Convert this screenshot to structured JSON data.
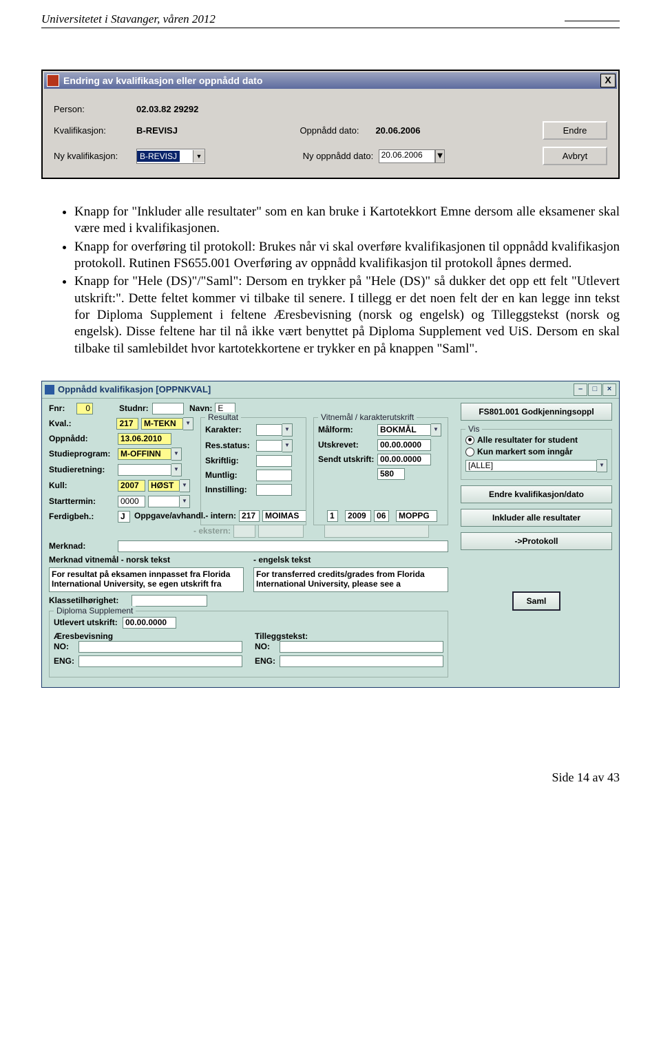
{
  "header": {
    "left": "Universitetet i Stavanger, våren 2012"
  },
  "dlg1": {
    "title": "Endring av kvalifikasjon eller oppnådd dato",
    "person_lbl": "Person:",
    "person_val": "02.03.82 29292",
    "kval_lbl": "Kvalifikasjon:",
    "kval_val": "B-REVISJ",
    "oppdato_lbl": "Oppnådd dato:",
    "oppdato_val": "20.06.2006",
    "nykval_lbl": "Ny kvalifikasjon:",
    "nykval_sel": "B-REVISJ",
    "nyoppdato_lbl": "Ny oppnådd dato:",
    "nyoppdato_val": "20.06.2006",
    "endre": "Endre",
    "avbryt": "Avbryt",
    "close": "X"
  },
  "bullets": {
    "b1": "Knapp for \"Inkluder alle resultater\" som en kan bruke i Kartotekkort Emne dersom alle eksamener skal være med i kvalifikasjonen.",
    "b2": "Knapp for overføring til protokoll: Brukes når vi skal overføre kvalifikasjonen til oppnådd kvalifikasjon protokoll. Rutinen FS655.001 Overføring av oppnådd kvalifikasjon til protokoll åpnes dermed.",
    "b3": "Knapp for \"Hele (DS)\"/\"Saml\": Dersom en trykker på \"Hele (DS)\" så dukker det opp ett felt \"Utlevert utskrift:\". Dette feltet kommer vi tilbake til senere. I tillegg er det noen felt der en kan legge inn tekst for Diploma Supplement i feltene Æresbevisning (norsk og engelsk) og Tilleggstekst (norsk og engelsk). Disse feltene har til nå ikke vært benyttet på Diploma Supplement ved UiS. Dersom en skal tilbake til samlebildet hvor kartotekkortene er trykker en på knappen \"Saml\"."
  },
  "dlg2": {
    "title": "Oppnådd kvalifikasjon [OPPNKVAL]",
    "fnr_lbl": "Fnr:",
    "fnr_val": "0",
    "studnr_lbl": "Studnr:",
    "navn_lbl": "Navn:",
    "navn_val": "E",
    "kval_lbl": "Kval.:",
    "kval_v1": "217",
    "kval_v2": "M-TEKN",
    "oppn_lbl": "Oppnådd:",
    "oppn_val": "13.06.2010",
    "stprog_lbl": "Studieprogram:",
    "stprog_val": "M-OFFINN",
    "stret_lbl": "Studieretning:",
    "kull_lbl": "Kull:",
    "kull_v1": "2007",
    "kull_v2": "HØST",
    "stt_lbl": "Starttermin:",
    "stt_val": "0000",
    "fb_lbl": "Ferdigbeh.:",
    "fb_val": "J",
    "oah_lbl": "Oppgave/avhandl.- intern:",
    "oah_v1": "217",
    "oah_v2": "MOIMAS",
    "oah_v3": "1",
    "oah_v4": "2009",
    "oah_v5": "06",
    "oah_v6": "MOPPG",
    "ekstern_lbl": "- ekstern:",
    "merk_lbl": "Merknad:",
    "res_leg": "Resultat",
    "kar_lbl": "Karakter:",
    "rs_lbl": "Res.status:",
    "skr_lbl": "Skriftlig:",
    "mun_lbl": "Muntlig:",
    "ins_lbl": "Innstilling:",
    "vk_leg": "Vitnemål / karakterutskrift",
    "mf_lbl": "Målform:",
    "mf_val": "BOKMÅL",
    "ut_lbl": "Utskrevet:",
    "ut_val": "00.00.0000",
    "su_lbl": "Sendt utskrift:",
    "su_val": "00.00.0000",
    "num": "580",
    "mn_lbl": "Merknad vitnemål - norsk tekst",
    "me_lbl": "- engelsk tekst",
    "mn_txt": "For resultat på eksamen innpasset fra Florida International University, se egen utskrift fra",
    "me_txt": "For transferred credits/grades from Florida International University, please see a",
    "kt_lbl": "Klassetilhørighet:",
    "ds_leg": "Diploma Supplement",
    "uu_lbl": "Utlevert utskrift:",
    "uu_val": "00.00.0000",
    "ab_lbl": "Æresbevisning",
    "tt_lbl": "Tilleggstekst:",
    "no_lbl": "NO:",
    "eng_lbl": "ENG:",
    "fsbtn": "FS801.001 Godkjenningsoppl",
    "vis_leg": "Vis",
    "r1": "Alle resultater for student",
    "r2": "Kun markert som inngår",
    "alle": "[ALLE]",
    "b_endre": "Endre kvalifikasjon/dato",
    "b_ink": "Inkluder alle resultater",
    "b_prot": "->Protokoll",
    "b_saml": "Saml"
  },
  "footer": "Side 14 av 43"
}
